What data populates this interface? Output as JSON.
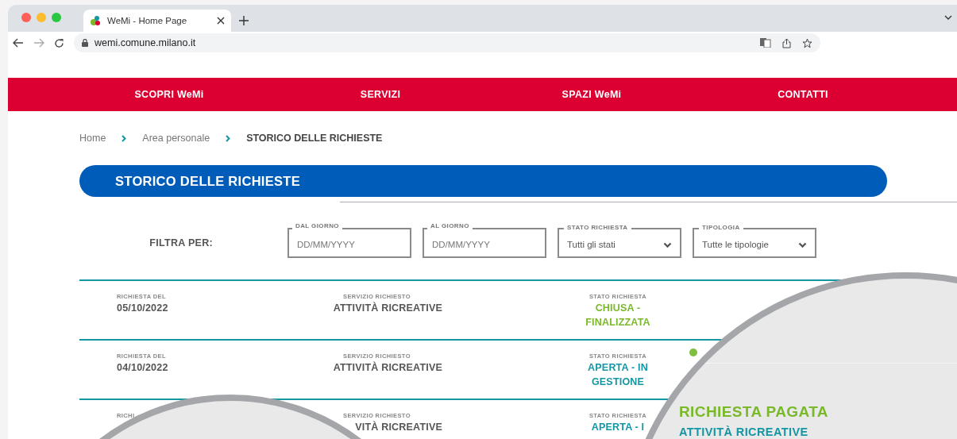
{
  "browser": {
    "tab_title": "WeMi - Home Page",
    "url": "wemi.comune.milano.it"
  },
  "nav": [
    "SCOPRI WeMi",
    "SERVIZI",
    "SPAZI WeMi",
    "CONTATTI"
  ],
  "breadcrumb": [
    {
      "label": "Home",
      "current": false
    },
    {
      "label": "Area personale",
      "current": false
    },
    {
      "label": "STORICO DELLE RICHIESTE",
      "current": true
    }
  ],
  "page_title": "STORICO DELLE RICHIESTE",
  "filters": {
    "label": "FILTRA PER:",
    "fields": [
      {
        "kind": "date",
        "label": "DAL GIORNO",
        "placeholder": "DD/MM/YYYY"
      },
      {
        "kind": "date",
        "label": "AL GIORNO",
        "placeholder": "DD/MM/YYYY"
      },
      {
        "kind": "select",
        "label": "STATO RICHIESTA",
        "value": "Tutti gli stati"
      },
      {
        "kind": "select",
        "label": "TIPOLOGIA",
        "value": "Tutte le tipologie"
      }
    ]
  },
  "requests": [
    {
      "date_label": "RICHIESTA DEL",
      "date": "05/10/2022",
      "service_label": "SERVIZIO RICHIESTO",
      "service": "ATTIVITÀ RICREATIVE",
      "status_label": "STATO RICHIESTA",
      "status": "CHIUSA - FINALIZZATA",
      "color": "#7ab929",
      "marker": false
    },
    {
      "date_label": "RICHIESTA DEL",
      "date": "04/10/2022",
      "service_label": "SERVIZIO RICHIESTO",
      "service": "ATTIVITÀ RICREATIVE",
      "status_label": "STATO RICHIESTA",
      "status": "APERTA - IN GESTIONE",
      "color": "#1496a4",
      "marker": true
    },
    {
      "date_label": "RICHI",
      "service_label": "SERVIZIO RICHIESTO",
      "service": "VITÀ RICREATIVE",
      "status_label": "STATO RICHIESTA",
      "status": "APERTA - I",
      "color": "#1496a4",
      "marker": false
    }
  ],
  "lens": {
    "title": "RICHIESTA PAGATA",
    "subtitle": "ATTIVITÀ RICREATIVE"
  }
}
